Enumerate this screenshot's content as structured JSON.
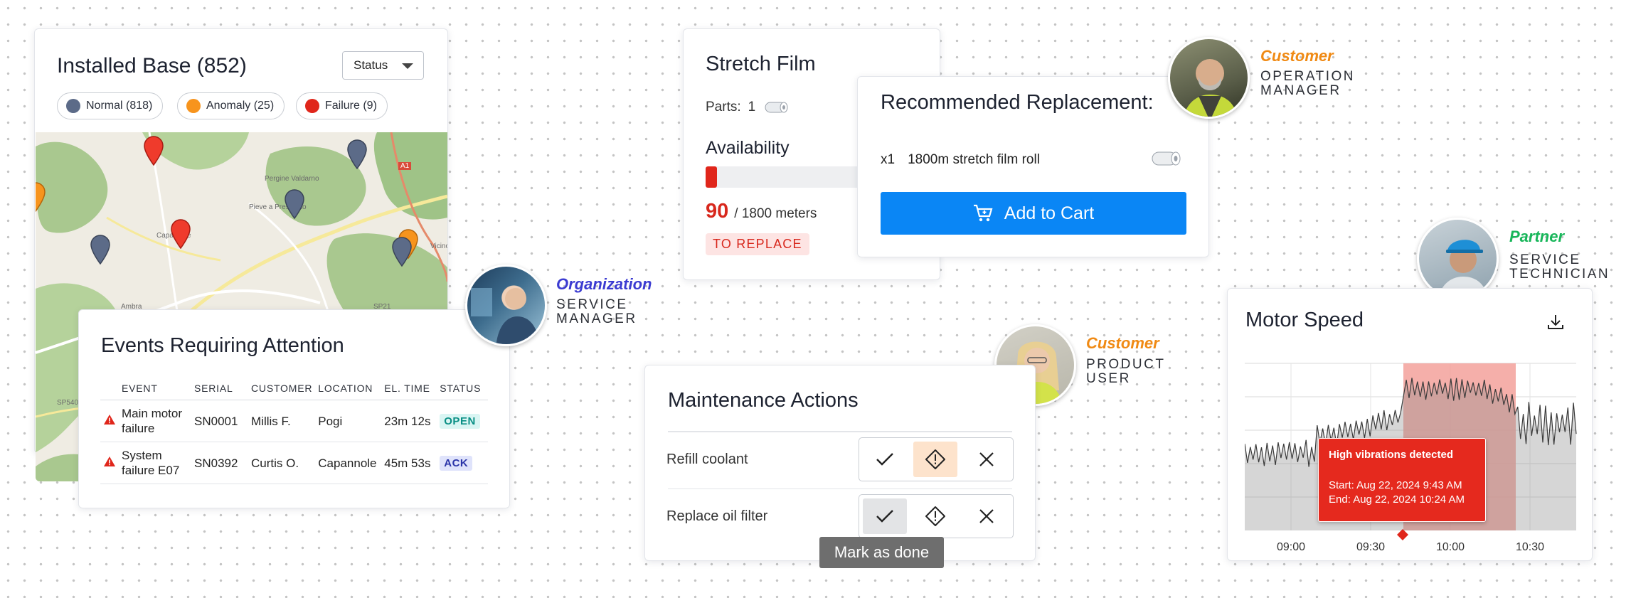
{
  "installed_base": {
    "title": "Installed Base (852)",
    "status_select": "Status",
    "legend": [
      {
        "label": "Normal (818)",
        "color": "#5c6b88"
      },
      {
        "label": "Anomaly (25)",
        "color": "#f7941d"
      },
      {
        "label": "Failure (9)",
        "color": "#e0261b"
      }
    ],
    "map_labels": [
      "Pergine Valdarno",
      "Pieve a Presciano",
      "Capannole",
      "Ambra",
      "Vicino",
      "SP21",
      "SP540",
      "A1"
    ]
  },
  "events": {
    "title": "Events Requiring Attention",
    "columns": [
      "EVENT",
      "SERIAL",
      "CUSTOMER",
      "LOCATION",
      "EL. TIME",
      "STATUS"
    ],
    "rows": [
      {
        "event": "Main motor failure",
        "serial": "SN0001",
        "customer": "Millis F.",
        "location": "Pogi",
        "el_time": "23m 12s",
        "status": "OPEN"
      },
      {
        "event": "System failure E07",
        "serial": "SN0392",
        "customer": "Curtis O.",
        "location": "Capannole",
        "el_time": "45m 53s",
        "status": "ACK"
      }
    ]
  },
  "personas": {
    "org": {
      "type": "Organization",
      "role_line1": "SERVICE",
      "role_line2": "MANAGER",
      "color": "#3b3bd1"
    },
    "op": {
      "type": "Customer",
      "role_line1": "OPERATION",
      "role_line2": "MANAGER",
      "color": "#f08a14"
    },
    "product": {
      "type": "Customer",
      "role_line1": "PRODUCT",
      "role_line2": "USER",
      "color": "#f08a14"
    },
    "partner": {
      "type": "Partner",
      "role_line1": "SERVICE",
      "role_line2": "TECHNICIAN",
      "color": "#18b65a"
    }
  },
  "stretch_film": {
    "title": "Stretch Film",
    "parts_label": "Parts:",
    "parts_count": "1",
    "availability_label": "Availability",
    "availability_value": "90",
    "availability_total": "/ 1800 meters",
    "availability_fraction": 0.05,
    "status_badge": "TO REPLACE"
  },
  "recommended": {
    "title": "Recommended Replacement:",
    "qty": "x1",
    "item": "1800m stretch film roll",
    "button": "Add to Cart"
  },
  "maintenance": {
    "title": "Maintenance Actions",
    "rows": [
      {
        "label": "Refill coolant",
        "selected": "warning"
      },
      {
        "label": "Replace oil filter",
        "selected": "done"
      }
    ],
    "tooltip": "Mark as done"
  },
  "motor_speed": {
    "title": "Motor Speed",
    "alert": {
      "title": "High vibrations detected",
      "start": "Start: Aug 22, 2024 9:43 AM",
      "end": "End: Aug 22, 2024 10:24 AM"
    },
    "x_ticks": [
      "09:00",
      "09:30",
      "10:00",
      "10:30"
    ]
  }
}
